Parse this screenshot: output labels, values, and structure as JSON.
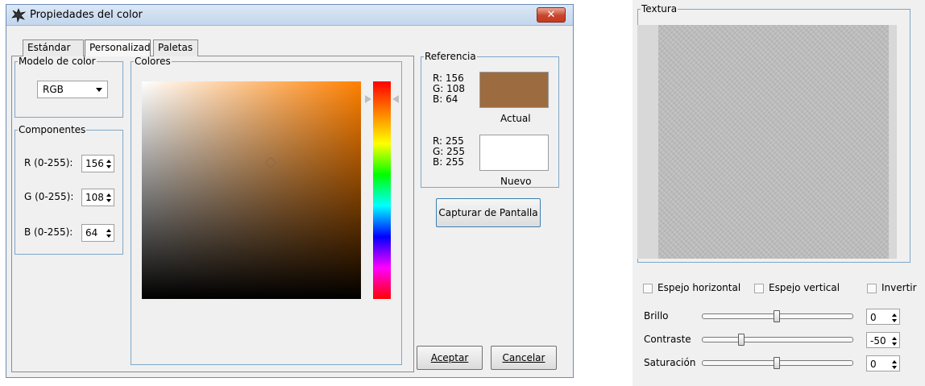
{
  "dialog": {
    "title": "Propiedades del color",
    "close_label": "✕",
    "tabs": [
      "Estándar",
      "Personalizado",
      "Paletas"
    ],
    "active_tab": "Personalizado"
  },
  "modelo": {
    "legend": "Modelo de color",
    "selected": "RGB"
  },
  "componentes": {
    "legend": "Componentes",
    "items": [
      {
        "label": "R (0-255):",
        "value": "156"
      },
      {
        "label": "G (0-255):",
        "value": "108"
      },
      {
        "label": "B (0-255):",
        "value": "64"
      }
    ]
  },
  "colores": {
    "legend": "Colores",
    "field_hue_color": "#ff8000"
  },
  "referencia": {
    "legend": "Referencia",
    "actual": {
      "text": "R: 156\nG: 108\nB: 64",
      "color": "#9c6c40",
      "caption": "Actual"
    },
    "nuevo": {
      "text": "R: 255\nG: 255\nB: 255",
      "color": "#ffffff",
      "caption": "Nuevo"
    }
  },
  "buttons": {
    "capturar": "Capturar de Pantalla",
    "aceptar": "Aceptar",
    "cancelar": "Cancelar"
  },
  "textura": {
    "legend": "Textura",
    "checkboxes": [
      {
        "label": "Espejo horizontal",
        "checked": false
      },
      {
        "label": "Espejo vertical",
        "checked": false
      },
      {
        "label": "Invertir",
        "checked": false
      }
    ],
    "sliders": [
      {
        "label": "Brillo",
        "value": "0",
        "level": 0.5
      },
      {
        "label": "Contraste",
        "value": "-50",
        "level": 0.25
      },
      {
        "label": "Saturación",
        "value": "0",
        "level": 0.5
      }
    ]
  }
}
